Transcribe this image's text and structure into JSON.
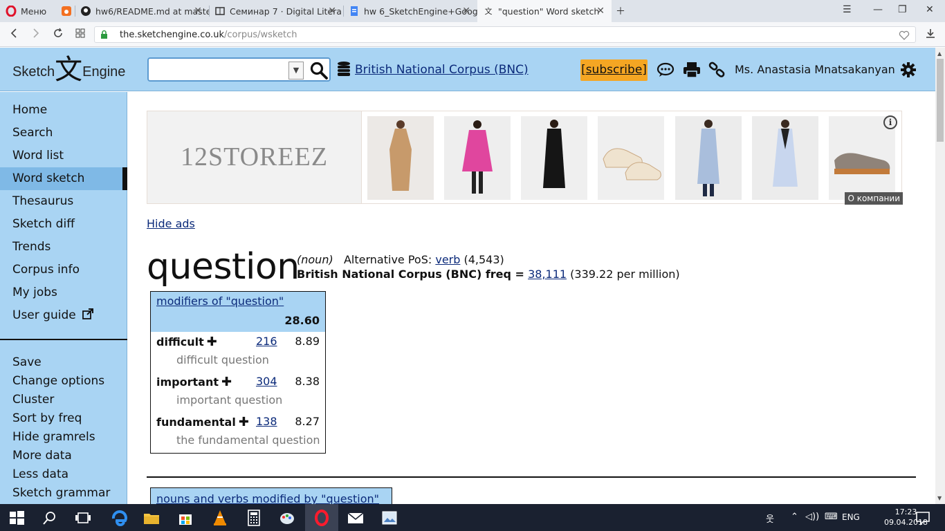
{
  "browser": {
    "menu_label": "Меню",
    "tabs": [
      {
        "title": "hw6/README.md at maste",
        "icon": "github-icon"
      },
      {
        "title": "Семинар 7 · Digital Litera",
        "icon": "book-icon"
      },
      {
        "title": "hw 6_SketchEngine+Goog",
        "icon": "docs-icon"
      },
      {
        "title": "\"question\" Word sketch",
        "icon": "sketchengine-icon"
      }
    ],
    "url_host": "the.sketchengine.co.uk",
    "url_path": "/corpus/wsketch"
  },
  "header": {
    "logo_left": "Sketch",
    "logo_glyph": "文",
    "logo_right": "Engine",
    "search_value": "",
    "corpus_name": "British National Corpus (BNC)",
    "subscribe_label": "[subscribe]",
    "user_name": "Ms. Anastasia Mnatsakanyan"
  },
  "sidebar": {
    "items": [
      {
        "label": "Home"
      },
      {
        "label": "Search"
      },
      {
        "label": "Word list"
      },
      {
        "label": "Word sketch"
      },
      {
        "label": "Thesaurus"
      },
      {
        "label": "Sketch diff"
      },
      {
        "label": "Trends"
      },
      {
        "label": "Corpus info"
      },
      {
        "label": "My jobs"
      },
      {
        "label": "User guide"
      }
    ],
    "actions": [
      {
        "label": "Save"
      },
      {
        "label": "Change options"
      },
      {
        "label": "Cluster"
      },
      {
        "label": "Sort by freq"
      },
      {
        "label": "Hide gramrels"
      },
      {
        "label": "More data"
      },
      {
        "label": "Less data"
      },
      {
        "label": "Sketch grammar"
      }
    ]
  },
  "ad": {
    "brand": "12STOREEZ",
    "company_label": "О компании"
  },
  "main": {
    "hide_ads": "Hide ads",
    "headword": "question",
    "pos": "(noun)",
    "alt_pos_label": "Alternative PoS:",
    "alt_pos_link": "verb",
    "alt_pos_count": "(4,543)",
    "freq_label": "British National Corpus (BNC) freq =",
    "freq_value": "38,111",
    "freq_per_million": "(339.22 per million)"
  },
  "gramrels": [
    {
      "title": "modifiers of \"question\"",
      "score": "28.60",
      "rows": [
        {
          "word": "difficult",
          "freq": "216",
          "score": "8.89",
          "example": "difficult question"
        },
        {
          "word": "important",
          "freq": "304",
          "score": "8.38",
          "example": "important question"
        },
        {
          "word": "fundamental",
          "freq": "138",
          "score": "8.27",
          "example": "the fundamental question"
        }
      ]
    },
    {
      "title": "nouns and verbs modified by \"question\""
    }
  ],
  "taskbar": {
    "lang": "ENG",
    "time": "17:23",
    "date": "09.04.2018"
  },
  "colors": {
    "accent": "#a9d4f3",
    "link": "#0b2a7a",
    "subscribe": "#f5a623"
  }
}
